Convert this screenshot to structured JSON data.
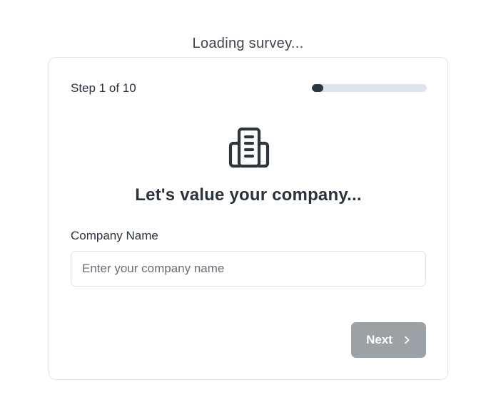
{
  "loading": {
    "text": "Loading survey..."
  },
  "step": {
    "label": "Step 1 of 10",
    "current": 1,
    "total": 10,
    "progress_fraction": 0.1
  },
  "icon": {
    "name": "building-icon"
  },
  "heading": {
    "text": "Let's value your company..."
  },
  "company_field": {
    "label": "Company Name",
    "placeholder": "Enter your company name",
    "value": ""
  },
  "next_button": {
    "label": "Next",
    "icon": "chevron-right-icon",
    "state": "disabled"
  },
  "colors": {
    "progress_fill": "#2f353d",
    "progress_track": "#dde4ec",
    "button_disabled": "#9ca1a6",
    "text_primary": "#2b323b",
    "card_border": "#e2e5ea"
  }
}
